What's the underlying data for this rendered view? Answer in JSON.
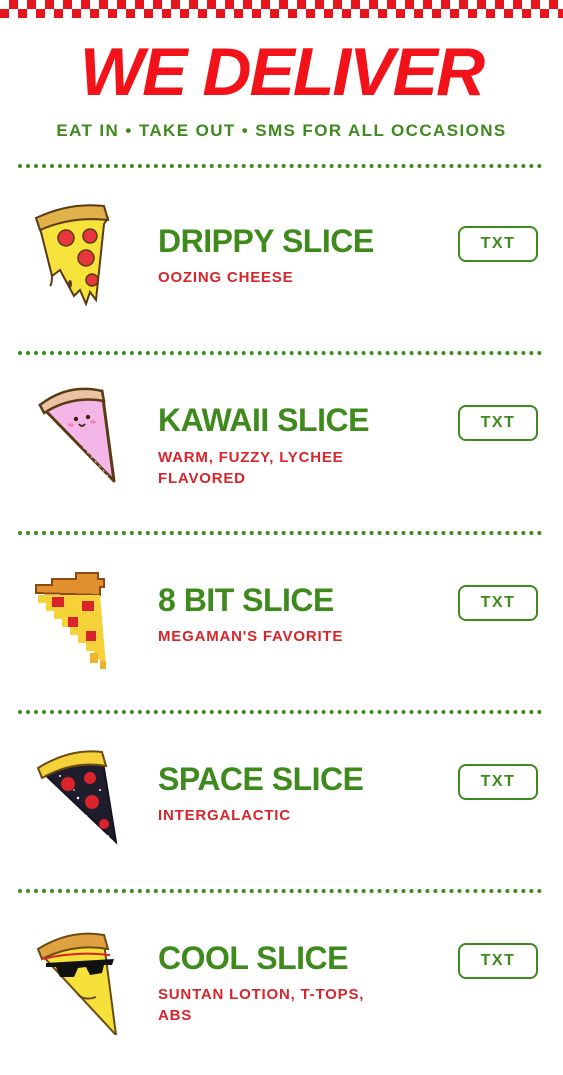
{
  "header": {
    "title": "WE DELIVER",
    "tagline": "EAT IN • TAKE OUT • SMS FOR ALL OCCASIONS"
  },
  "colors": {
    "brand_red": "#f2121a",
    "brand_green": "#3f8a1c",
    "checker_red": "#e8141c"
  },
  "menu": {
    "items": [
      {
        "name": "DRIPPY SLICE",
        "description": "OOZING CHEESE",
        "button": "TXT",
        "icon": "drippy-pizza-slice-icon"
      },
      {
        "name": "KAWAII SLICE",
        "description": "WARM, FUZZY, LYCHEE FLAVORED",
        "button": "TXT",
        "icon": "kawaii-pizza-slice-icon"
      },
      {
        "name": "8 BIT SLICE",
        "description": "MEGAMAN'S FAVORITE",
        "button": "TXT",
        "icon": "pixel-pizza-slice-icon"
      },
      {
        "name": "SPACE SLICE",
        "description": "INTERGALACTIC",
        "button": "TXT",
        "icon": "space-pizza-slice-icon"
      },
      {
        "name": "COOL SLICE",
        "description": "SUNTAN LOTION, T-TOPS, ABS",
        "button": "TXT",
        "icon": "sunglasses-pizza-slice-icon"
      }
    ]
  }
}
